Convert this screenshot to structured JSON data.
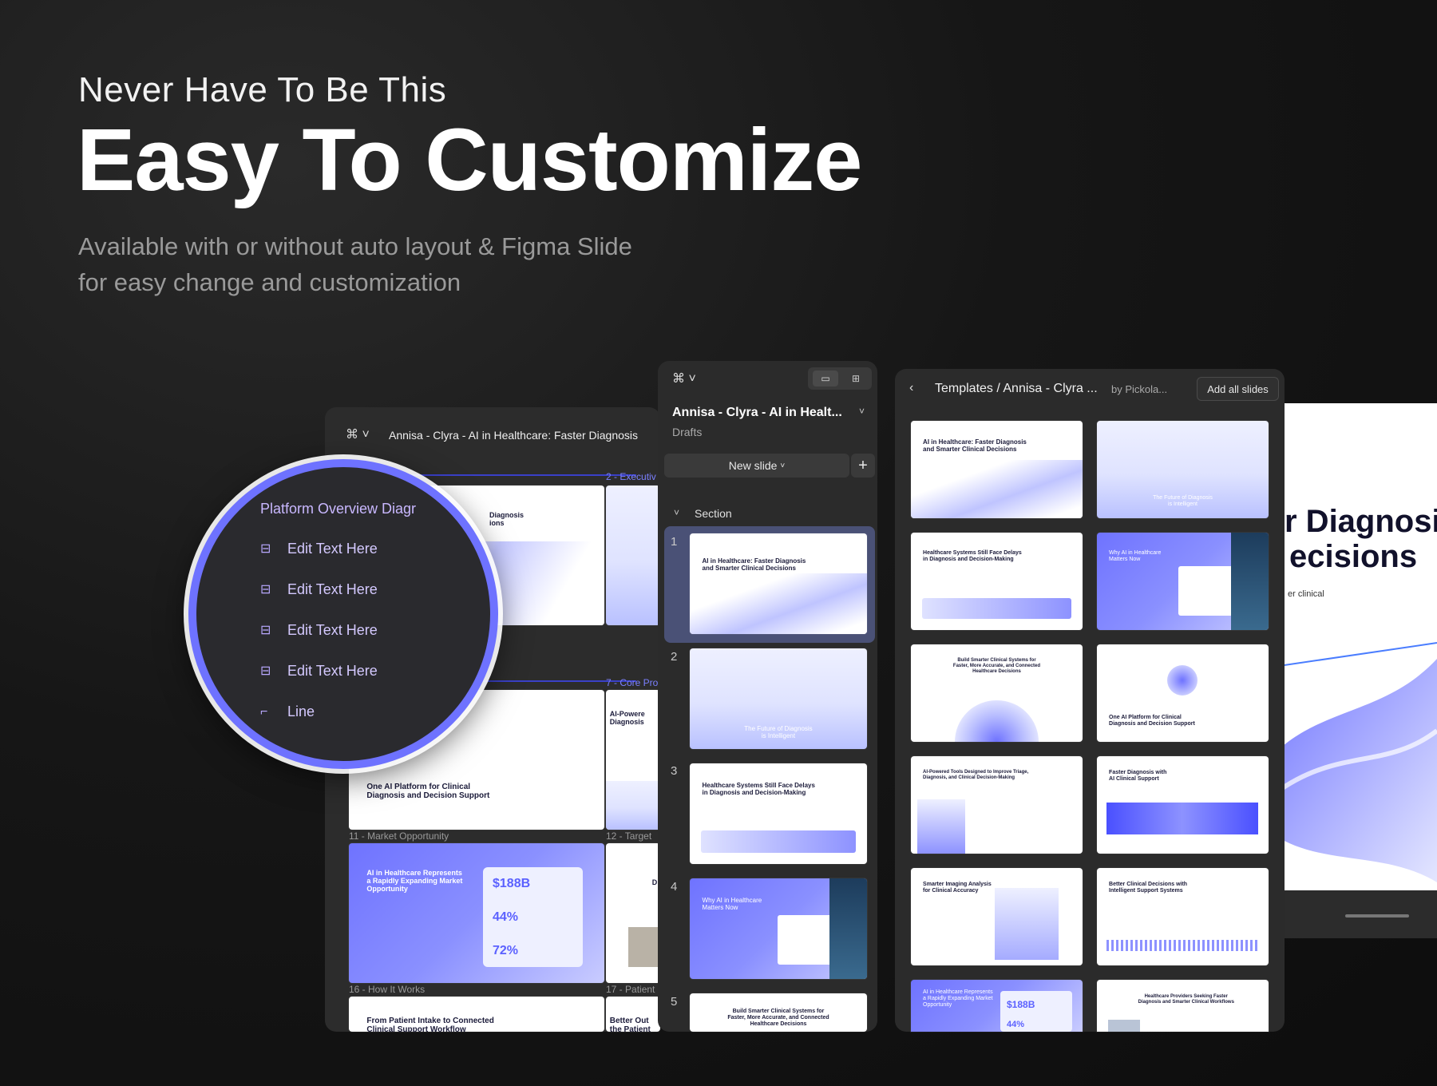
{
  "hero": {
    "eyebrow": "Never Have To Be This",
    "headline": "Easy To Customize",
    "sub_line1": "Available with or without auto layout  & Figma Slide",
    "sub_line2": "for easy change and customization"
  },
  "left_panel": {
    "title": "Annisa - Clyra - AI in Healthcare: Faster Diagnosis",
    "section_labels": [
      "2 - Executiv",
      "7 - Core Pro",
      "11 - Market Opportunity",
      "12 - Target",
      "16 - How It Works",
      "17 - Patient"
    ],
    "thumb_texts": {
      "t1": "Diagnosis\nions",
      "t_mid_right": "AI-Powere\nDiagnosis",
      "t_platform": "One AI Platform for Clinical\nDiagnosis and Decision Support",
      "t_market": "AI in Healthcare Represents\na Rapidly Expanding Market\nOpportunity",
      "stat1": "$188B",
      "stat2": "44%",
      "stat3": "72%",
      "t_intake": "From Patient Intake to Connected\nClinical Support Workflow",
      "t_better": "Better Out\nthe Patient",
      "t_d": "D"
    }
  },
  "zoom_circle": {
    "header": "Platform Overview Diagr",
    "items": [
      {
        "label": "Edit Text Here",
        "icon": "align-top-icon"
      },
      {
        "label": "Edit Text Here",
        "icon": "align-top-icon"
      },
      {
        "label": "Edit Text Here",
        "icon": "align-top-icon"
      },
      {
        "label": "Edit Text Here",
        "icon": "align-top-icon"
      },
      {
        "label": "Line",
        "icon": "line-icon"
      }
    ]
  },
  "middle_panel": {
    "file_title": "Annisa - Clyra - AI in Healt...",
    "location": "Drafts",
    "new_slide": "New slide",
    "section": "Section",
    "slides": [
      {
        "num": "1",
        "title": "AI in Healthcare: Faster Diagnosis\nand Smarter Clinical Decisions"
      },
      {
        "num": "2",
        "title": "The Future of Diagnosis\nis Intelligent"
      },
      {
        "num": "3",
        "title": "Healthcare Systems Still Face Delays\nin Diagnosis and Decision-Making"
      },
      {
        "num": "4",
        "title": "Why AI in Healthcare\nMatters Now"
      },
      {
        "num": "5",
        "title": "Build Smarter Clinical Systems for\nFaster, More Accurate, and Connected\nHealthcare Decisions"
      }
    ]
  },
  "right_panel": {
    "breadcrumb": "Templates / Annisa - Clyra ...",
    "author": "by Pickola...",
    "add_all": "Add all slides",
    "thumbs": [
      "AI in Healthcare: Faster Diagnosis\nand Smarter Clinical Decisions",
      "The Future of Diagnosis\nis Intelligent",
      "Healthcare Systems Still Face Delays\nin Diagnosis and Decision-Making",
      "Why AI in Healthcare\nMatters Now",
      "Build Smarter Clinical Systems for\nFaster, More Accurate, and Connected\nHealthcare Decisions",
      "One AI Platform for Clinical\nDiagnosis and Decision Support",
      "AI-Powered Tools Designed to Improve Triage,\nDiagnosis, and Clinical Decision-Making",
      "Faster Diagnosis with\nAI Clinical Support",
      "Smarter Imaging Analysis\nfor Clinical Accuracy",
      "Better Clinical Decisions with\nIntelligent Support Systems",
      "AI in Healthcare Represents\na Rapidly Expanding Market\nOpportunity",
      "Healthcare Providers Seeking Faster\nDiagnosis and Smarter Clinical Workflows"
    ],
    "stat": "$188B",
    "stat2": "44%"
  },
  "far_right": {
    "line1": "r Diagnosis",
    "line2": "ecisions",
    "line3": "er clinical"
  },
  "colors": {
    "accent": "#6e72ff",
    "panel": "#2c2c2c",
    "selected": "#4a5176"
  }
}
